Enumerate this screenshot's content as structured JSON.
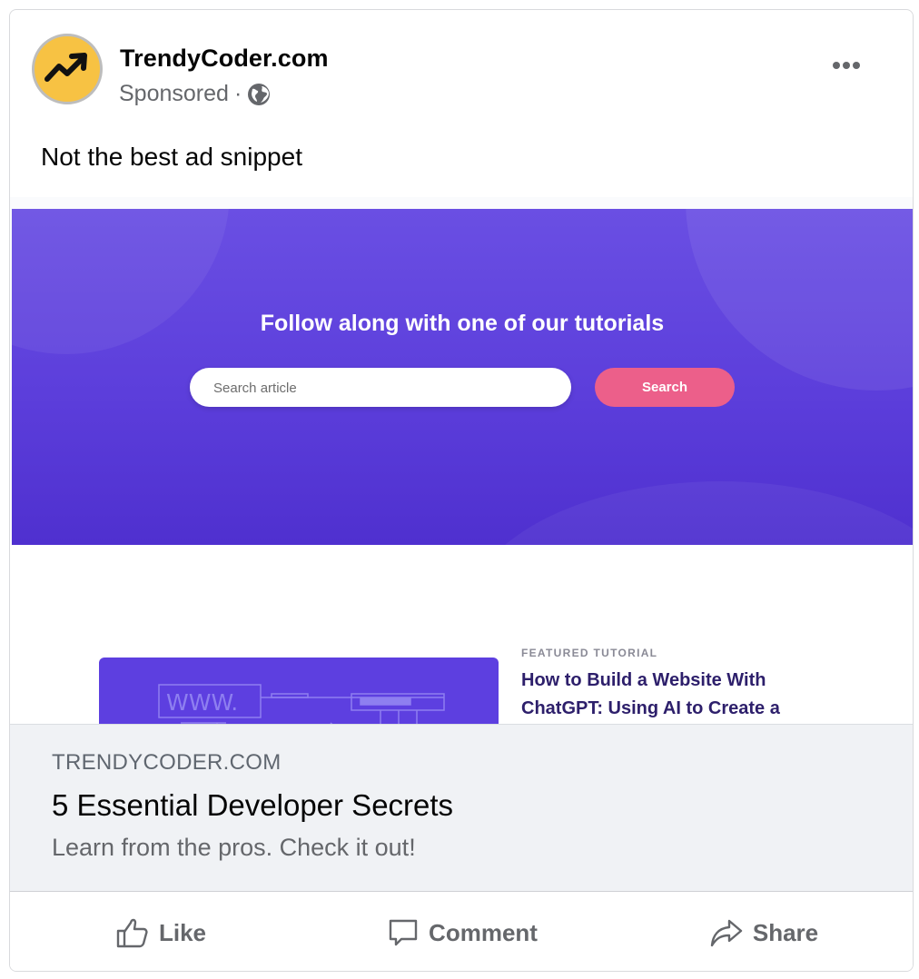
{
  "post": {
    "page_name": "TrendyCoder.com",
    "sponsored_label": "Sponsored",
    "separator": "·",
    "audience_icon": "globe-icon",
    "more_icon": "more-options-icon",
    "text": "Not the best ad snippet"
  },
  "preview": {
    "hero_title": "Follow along with one of our tutorials",
    "search_placeholder": "Search article",
    "search_button": "Search",
    "featured_label": "FEATURED TUTORIAL",
    "featured_title": "How to Build a Website With ChatGPT: Using AI to Create a",
    "illustration_text": "WWW.",
    "colors": {
      "hero": "#5c3edb",
      "button": "#ec5f8a",
      "featured_title": "#2d1f6b"
    }
  },
  "link": {
    "domain": "TRENDYCODER.COM",
    "headline": "5 Essential Developer Secrets",
    "description": "Learn from the pros. Check it out!"
  },
  "actions": [
    {
      "label": "Like",
      "icon": "thumbs-up-icon"
    },
    {
      "label": "Comment",
      "icon": "comment-icon"
    },
    {
      "label": "Share",
      "icon": "share-icon"
    }
  ]
}
